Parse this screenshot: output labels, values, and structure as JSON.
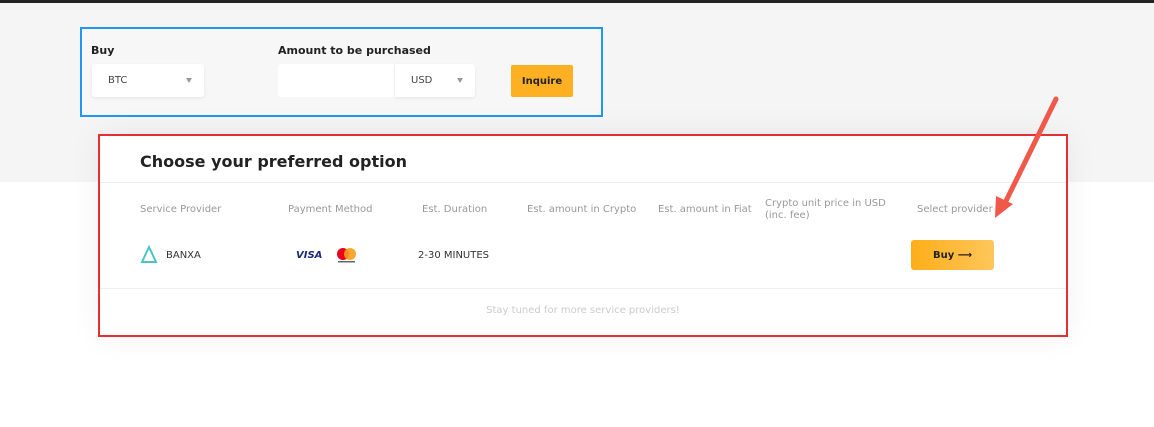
{
  "form": {
    "buy_label": "Buy",
    "buy_value": "BTC",
    "amount_label": "Amount to be purchased",
    "amount_value": "",
    "currency": "USD",
    "inquire": "Inquire"
  },
  "card": {
    "title": "Choose your preferred option",
    "headers": [
      "Service Provider",
      "Payment Method",
      "Est. Duration",
      "Est. amount in Crypto",
      "Est. amount in Fiat",
      "Crypto unit price in USD (inc. fee)",
      "Select provider"
    ],
    "row": {
      "provider": "BANXA",
      "visa": "VISA",
      "duration": "2-30 MINUTES",
      "buy": "Buy"
    },
    "footer": "Stay tuned for more service providers!"
  },
  "colors": {
    "accent": "#fdb022",
    "highlight_blue": "#2196f3",
    "highlight_red": "#e53030",
    "arrow": "#f0584a"
  }
}
